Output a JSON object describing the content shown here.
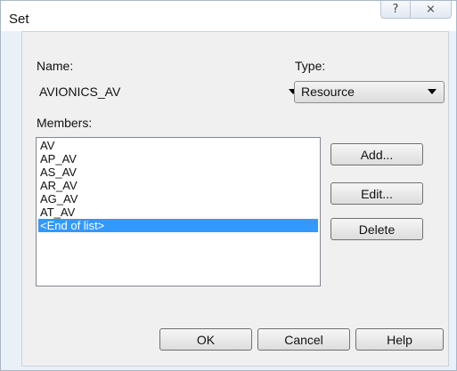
{
  "dialog": {
    "title": "Set",
    "help_glyph": "?",
    "close_glyph": "⨯"
  },
  "form": {
    "name_label": "Name:",
    "name_value": "AVIONICS_AV",
    "type_label": "Type:",
    "type_value": "Resource",
    "members_label": "Members:"
  },
  "members": {
    "items": [
      "AV",
      "AP_AV",
      "AS_AV",
      "AR_AV",
      "AG_AV",
      "AT_AV",
      "<End of list>"
    ],
    "selected_index": 6
  },
  "buttons": {
    "add": "Add...",
    "edit": "Edit...",
    "delete": "Delete",
    "ok": "OK",
    "cancel": "Cancel",
    "help": "Help"
  }
}
